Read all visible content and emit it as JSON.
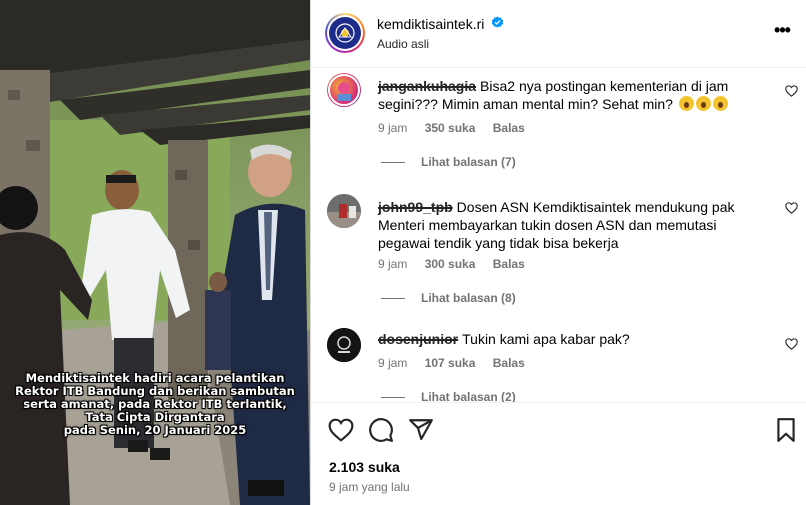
{
  "post": {
    "caption_lines": [
      "Mendiktisaintek hadiri acara pelantikan",
      "Rektor ITB Bandung dan berikan sambutan",
      "serta amanat, pada Rektor ITB terlantik,",
      "Tata Cipta Dirgantara",
      "pada Senin, 20 Januari 2025"
    ]
  },
  "header": {
    "username": "kemdiktisaintek.ri",
    "subtitle": "Audio asli",
    "verified_icon": "verified-badge-icon",
    "more_icon": "more-options-icon"
  },
  "comments": [
    {
      "username": "jangankuhagia",
      "text": "Bisa2 nya postingan kementerian di jam segini??? Mimin aman mental min? Sehat min?",
      "emoji_count": 3,
      "time": "9 jam",
      "likes": "350 suka",
      "reply": "Balas",
      "view_replies": "Lihat balasan (7)"
    },
    {
      "username": "john99_tpb",
      "text": "Dosen ASN Kemdiktisaintek mendukung pak Menteri membayarkan tukin dosen ASN dan memutasi pegawai tendik yang tidak bisa bekerja",
      "time": "9 jam",
      "likes": "300 suka",
      "reply": "Balas",
      "view_replies": "Lihat balasan (8)"
    },
    {
      "username": "dosenjunior",
      "text": "Tukin kami apa kabar pak?",
      "time": "9 jam",
      "likes": "107 suka",
      "reply": "Balas",
      "view_replies": "Lihat balasan (2)"
    }
  ],
  "actions": {
    "likes": "2.103 suka",
    "time": "9 jam yang lalu"
  },
  "colors": {
    "verified": "#0095f6",
    "secondary_text": "#737373",
    "logo": "#1d2b8a"
  }
}
